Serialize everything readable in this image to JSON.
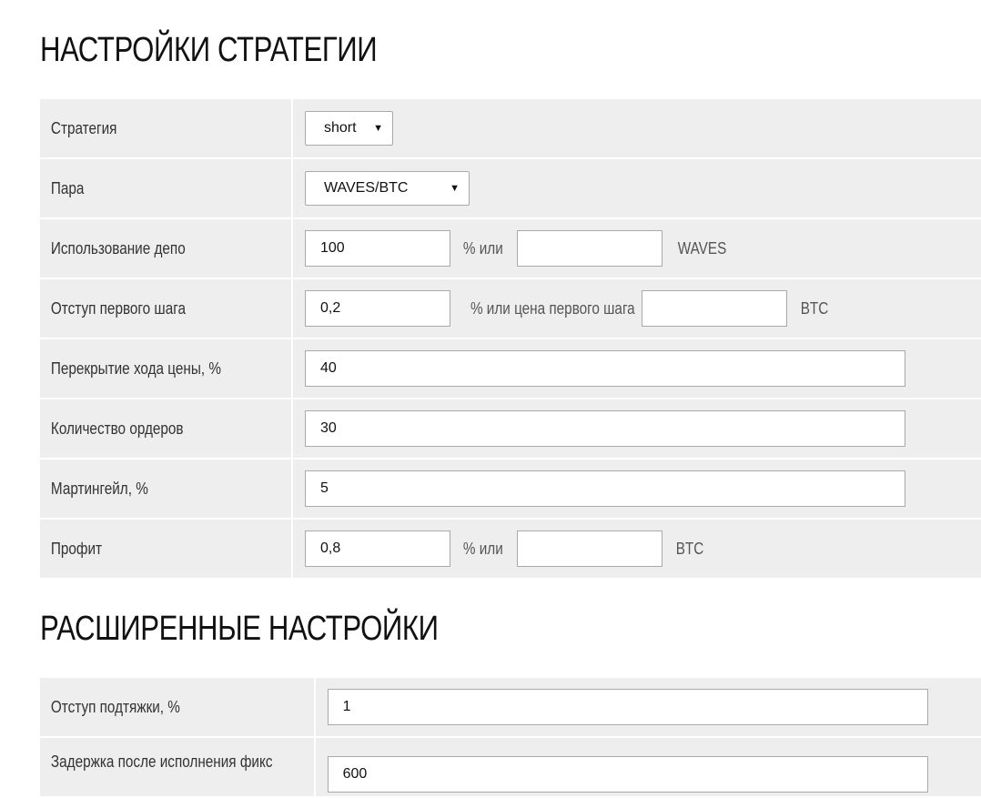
{
  "strategy_section": {
    "title": "НАСТРОЙКИ СТРАТЕГИИ",
    "rows": {
      "strategy": {
        "label": "Стратегия",
        "selected": "short"
      },
      "pair": {
        "label": "Пара",
        "selected": "WAVES/BTC"
      },
      "deposit": {
        "label": "Использование депо",
        "percent_value": "100",
        "separator": "%  или",
        "amount_value": "",
        "unit": "WAVES"
      },
      "first_step": {
        "label": "Отступ первого шага",
        "value": "0,2",
        "separator": "% или цена первого шага",
        "price_value": "",
        "unit": "BTC"
      },
      "overlap": {
        "label": "Перекрытие хода цены, %",
        "value": "40"
      },
      "orders": {
        "label": "Количество ордеров",
        "value": "30"
      },
      "martingale": {
        "label": "Мартингейл, %",
        "value": "5"
      },
      "profit": {
        "label": "Профит",
        "value": "0,8",
        "separator": "%  или",
        "amount_value": "",
        "unit": "BTC"
      }
    }
  },
  "advanced_section": {
    "title": "РАСШИРЕННЫЕ НАСТРОЙКИ",
    "rows": {
      "trailing": {
        "label": "Отступ подтяжки, %",
        "value": "1"
      },
      "delay": {
        "label": "Задержка после исполнения фикс",
        "value": "600"
      }
    }
  }
}
